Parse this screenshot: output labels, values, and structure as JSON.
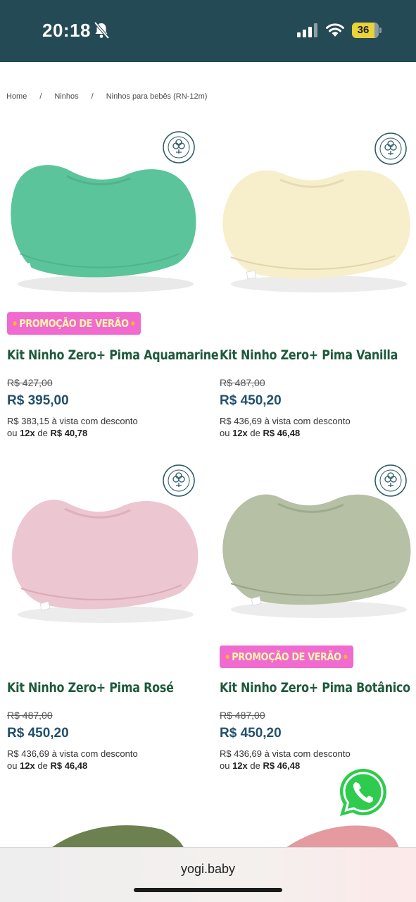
{
  "status_bar": {
    "time": "20:18",
    "battery_level": "36",
    "bell_icon": "bell-slash-icon",
    "signal_icon": "cellular-signal-icon",
    "wifi_icon": "wifi-icon",
    "background": "#244a55"
  },
  "breadcrumb": [
    {
      "label": "Home"
    },
    {
      "label": "Ninhos"
    },
    {
      "label": "Ninhos para bebês (RN-12m)"
    }
  ],
  "products": [
    {
      "name": "Kit Ninho Zero+ Pima Aquamarine",
      "promo": "PROMOÇÃO DE VERÃO",
      "old_price": "R$ 427,00",
      "price": "R$ 395,00",
      "cash_price": "R$ 383,15",
      "cash_text": " à vista com desconto",
      "installments_prefix": "ou ",
      "installments_count": "12x",
      "installments_mid": " de ",
      "installment_value": "R$ 40,78",
      "badge": "100% ALGODÃO PIMA",
      "color": "#5cc49a"
    },
    {
      "name": "Kit Ninho Zero+ Pima Vanilla",
      "promo": "",
      "old_price": "R$ 487,00",
      "price": "R$ 450,20",
      "cash_price": "R$ 436,69",
      "cash_text": " à vista com desconto",
      "installments_prefix": "ou ",
      "installments_count": "12x",
      "installments_mid": " de ",
      "installment_value": "R$ 46,48",
      "badge": "100% ALGODÃO PIMA",
      "color": "#f7efcb"
    },
    {
      "name": "Kit Ninho Zero+ Pima Rosé",
      "promo": "",
      "old_price": "R$ 487,00",
      "price": "R$ 450,20",
      "cash_price": "R$ 436,69",
      "cash_text": " à vista com desconto",
      "installments_prefix": "ou ",
      "installments_count": "12x",
      "installments_mid": " de ",
      "installment_value": "R$ 46,48",
      "badge": "100% ALGODÃO PIMA",
      "color": "#ecc6d0"
    },
    {
      "name": "Kit Ninho Zero+ Pima Botânico",
      "promo": "PROMOÇÃO DE VERÃO",
      "old_price": "R$ 487,00",
      "price": "R$ 450,20",
      "cash_price": "R$ 436,69",
      "cash_text": " à vista com desconto",
      "installments_prefix": "ou ",
      "installments_count": "12x",
      "installments_mid": " de ",
      "installment_value": "R$ 46,48",
      "badge": "100% ALGODÃO PIMA",
      "color": "#b5c0a5"
    }
  ],
  "partial_products": [
    {
      "color": "#6d8050"
    },
    {
      "color": "#e49a9e"
    }
  ],
  "whatsapp": {
    "icon": "whatsapp-icon",
    "color": "#2ecb4e"
  },
  "url_bar": {
    "url": "yogi.baby"
  }
}
